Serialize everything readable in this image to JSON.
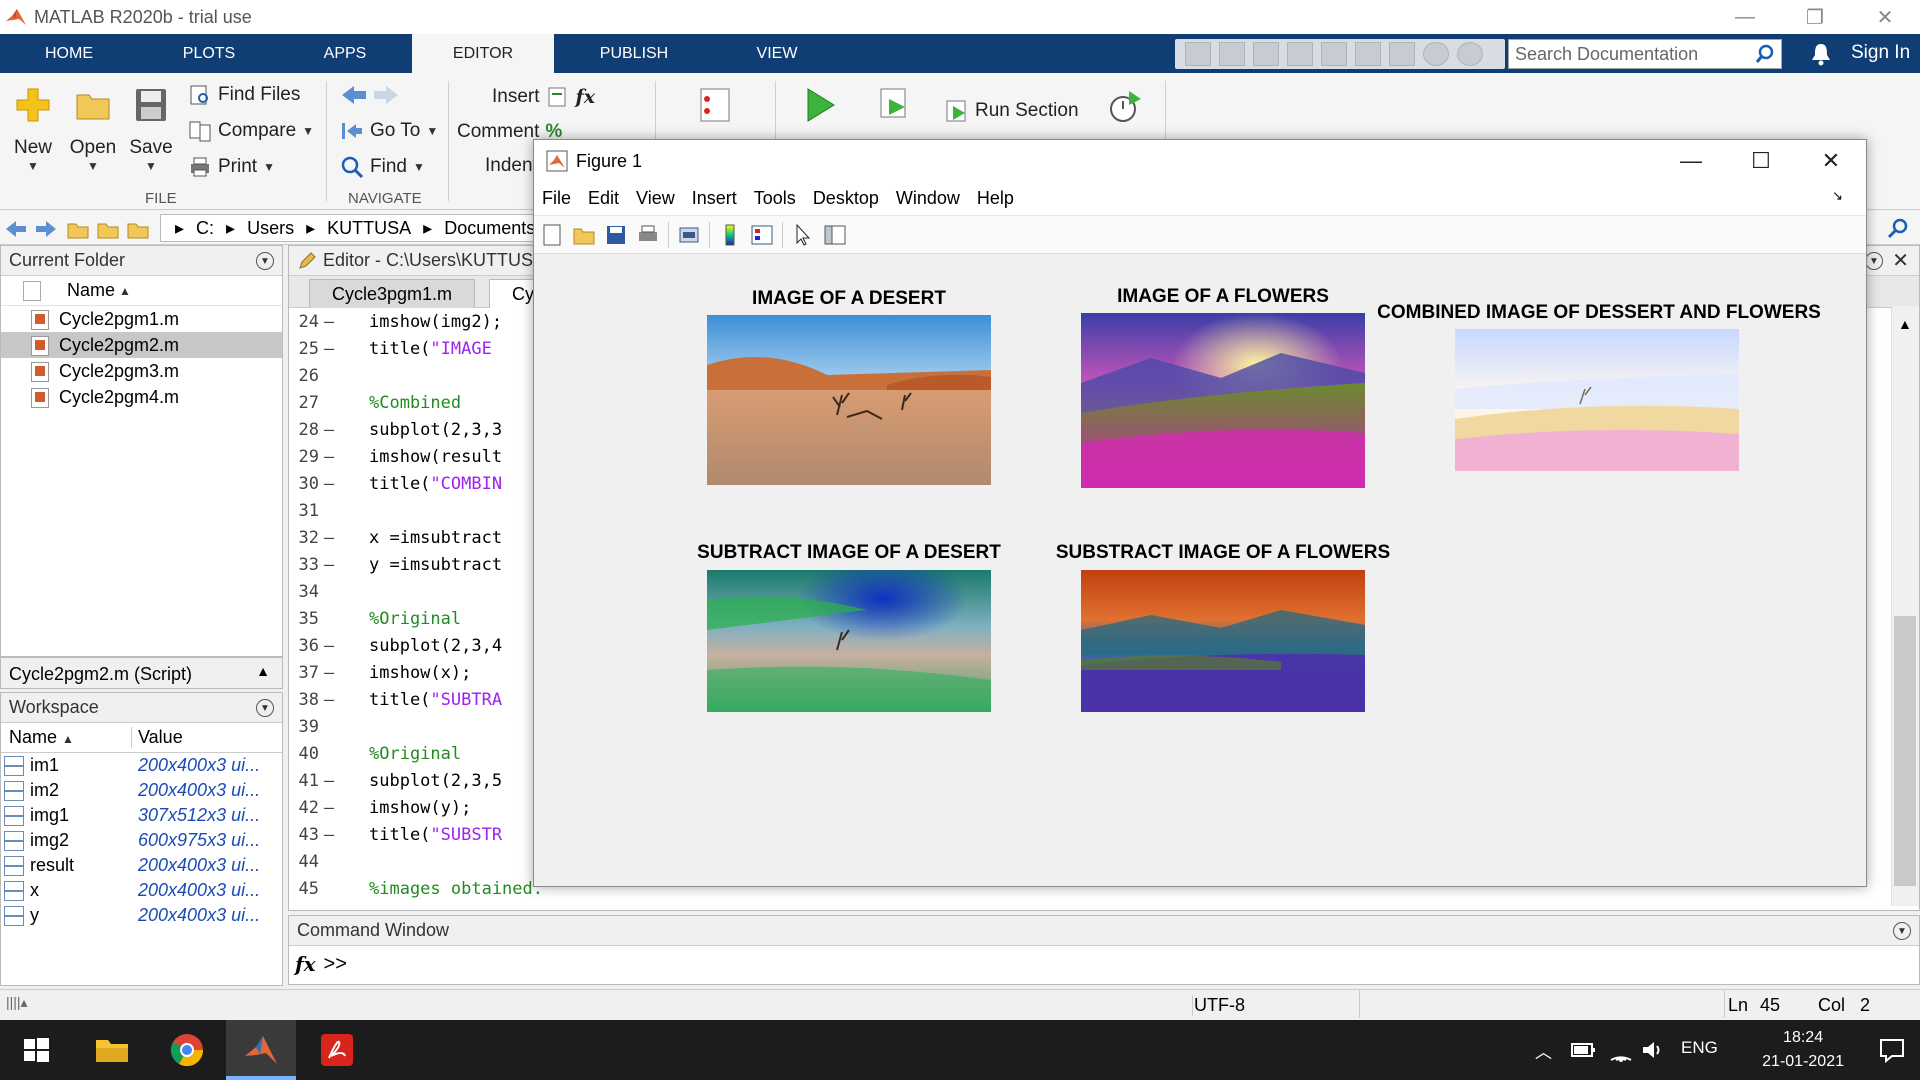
{
  "app": {
    "title": "MATLAB R2020b - trial use",
    "window_controls": [
      "—",
      "❐",
      "✕"
    ]
  },
  "ribbon_tabs": [
    "HOME",
    "PLOTS",
    "APPS",
    "EDITOR",
    "PUBLISH",
    "VIEW"
  ],
  "active_tab": "EDITOR",
  "search": {
    "placeholder": "Search Documentation"
  },
  "sign_in": "Sign In",
  "ribbon": {
    "new": "New",
    "open": "Open",
    "save": "Save",
    "find_files": "Find Files",
    "compare": "Compare",
    "print": "Print",
    "go_to": "Go To",
    "find": "Find",
    "insert": "Insert",
    "comment": "Comment",
    "indent": "Indent",
    "run_section": "Run Section",
    "group_file": "FILE",
    "group_navigate": "NAVIGATE",
    "fx": "fx"
  },
  "address": {
    "parts": [
      "C:",
      "Users",
      "KUTTUSA",
      "Documents"
    ]
  },
  "current_folder": {
    "title": "Current Folder",
    "column": "Name",
    "files": [
      {
        "name": "Cycle2pgm1.m"
      },
      {
        "name": "Cycle2pgm2.m"
      },
      {
        "name": "Cycle2pgm3.m"
      },
      {
        "name": "Cycle2pgm4.m"
      }
    ],
    "detail": "Cycle2pgm2.m  (Script)"
  },
  "workspace": {
    "title": "Workspace",
    "col_name": "Name",
    "col_value": "Value",
    "vars": [
      {
        "name": "im1",
        "value": "200x400x3 ui..."
      },
      {
        "name": "im2",
        "value": "200x400x3 ui..."
      },
      {
        "name": "img1",
        "value": "307x512x3 ui..."
      },
      {
        "name": "img2",
        "value": "600x975x3 ui..."
      },
      {
        "name": "result",
        "value": "200x400x3 ui..."
      },
      {
        "name": "x",
        "value": "200x400x3 ui..."
      },
      {
        "name": "y",
        "value": "200x400x3 ui..."
      }
    ]
  },
  "editor": {
    "title": "Editor - C:\\Users\\KUTTUSA",
    "tabs": [
      "Cycle3pgm1.m",
      "Cyc"
    ],
    "lines": [
      {
        "n": "24",
        "dash": "–",
        "text": "imshow(img2);",
        "cls": ""
      },
      {
        "n": "25",
        "dash": "–",
        "text": "title(",
        "str": "\"IMAGE",
        "cls": ""
      },
      {
        "n": "26",
        "dash": "",
        "text": "",
        "cls": ""
      },
      {
        "n": "27",
        "dash": "",
        "text": "%Combined",
        "cls": "c-green"
      },
      {
        "n": "28",
        "dash": "–",
        "text": "subplot(2,3,3",
        "cls": ""
      },
      {
        "n": "29",
        "dash": "–",
        "text": "imshow(result",
        "cls": ""
      },
      {
        "n": "30",
        "dash": "–",
        "text": "title(",
        "str": "\"COMBIN",
        "cls": ""
      },
      {
        "n": "31",
        "dash": "",
        "text": "",
        "cls": ""
      },
      {
        "n": "32",
        "dash": "–",
        "text": "x =imsubtract",
        "cls": ""
      },
      {
        "n": "33",
        "dash": "–",
        "text": "y =imsubtract",
        "cls": ""
      },
      {
        "n": "34",
        "dash": "",
        "text": "",
        "cls": ""
      },
      {
        "n": "35",
        "dash": "",
        "text": "%Original",
        "cls": "c-green"
      },
      {
        "n": "36",
        "dash": "–",
        "text": "subplot(2,3,4",
        "cls": ""
      },
      {
        "n": "37",
        "dash": "–",
        "text": "imshow(x);",
        "cls": ""
      },
      {
        "n": "38",
        "dash": "–",
        "text": "title(",
        "str": "\"SUBTRA",
        "cls": ""
      },
      {
        "n": "39",
        "dash": "",
        "text": "",
        "cls": ""
      },
      {
        "n": "40",
        "dash": "",
        "text": "%Original",
        "cls": "c-green"
      },
      {
        "n": "41",
        "dash": "–",
        "text": "subplot(2,3,5",
        "cls": ""
      },
      {
        "n": "42",
        "dash": "–",
        "text": "imshow(y);",
        "cls": ""
      },
      {
        "n": "43",
        "dash": "–",
        "text": "title(",
        "str": "\"SUBSTR",
        "cls": ""
      },
      {
        "n": "44",
        "dash": "",
        "text": "",
        "cls": ""
      },
      {
        "n": "45",
        "dash": "",
        "text": "%images obtained.",
        "cls": "c-green"
      }
    ]
  },
  "command_window": {
    "title": "Command Window",
    "fx": "fx",
    "prompt": ">>"
  },
  "status": {
    "encoding": "UTF-8",
    "ln_label": "Ln",
    "ln": "45",
    "col_label": "Col",
    "col": "2"
  },
  "taskbar": {
    "lang": "ENG",
    "time": "18:24",
    "date": "21-01-2021"
  },
  "figure": {
    "title": "Figure 1",
    "menu": [
      "File",
      "Edit",
      "View",
      "Insert",
      "Tools",
      "Desktop",
      "Window",
      "Help"
    ],
    "window_controls": [
      "—",
      "☐",
      "✕"
    ],
    "subplots": [
      {
        "title": "IMAGE OF A DESERT"
      },
      {
        "title": "IMAGE OF A FLOWERS"
      },
      {
        "title": "COMBINED IMAGE OF DESSERT AND FLOWERS"
      },
      {
        "title": "SUBTRACT IMAGE OF A DESERT"
      },
      {
        "title": "SUBSTRACT IMAGE OF A FLOWERS"
      }
    ]
  },
  "colors": {
    "ribbon_blue": "#0f3d74",
    "matlab_orange": "#e16737",
    "code_green": "#228b22",
    "code_purple": "#a020f0",
    "workspace_value_blue": "#1a4bb5"
  }
}
